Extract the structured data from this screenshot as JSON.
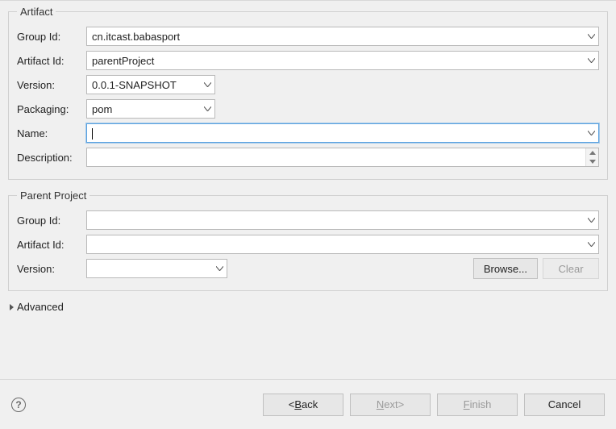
{
  "artifact": {
    "legend": "Artifact",
    "labels": {
      "groupId": "Group Id:",
      "artifactId": "Artifact Id:",
      "version": "Version:",
      "packaging": "Packaging:",
      "name": "Name:",
      "description": "Description:"
    },
    "values": {
      "groupId": "cn.itcast.babasport",
      "artifactId": "parentProject",
      "version": "0.0.1-SNAPSHOT",
      "packaging": "pom",
      "name": "",
      "description": ""
    }
  },
  "parent": {
    "legend": "Parent Project",
    "labels": {
      "groupId": "Group Id:",
      "artifactId": "Artifact Id:",
      "version": "Version:"
    },
    "values": {
      "groupId": "",
      "artifactId": "",
      "version": ""
    },
    "buttons": {
      "browse": "Browse...",
      "clear": "Clear"
    }
  },
  "advanced": {
    "label": "Advanced"
  },
  "footer": {
    "back": "Back",
    "backPrefix": "< ",
    "next": "Next",
    "nextSuffix": " >",
    "finish": "Finish",
    "cancel": "Cancel"
  }
}
